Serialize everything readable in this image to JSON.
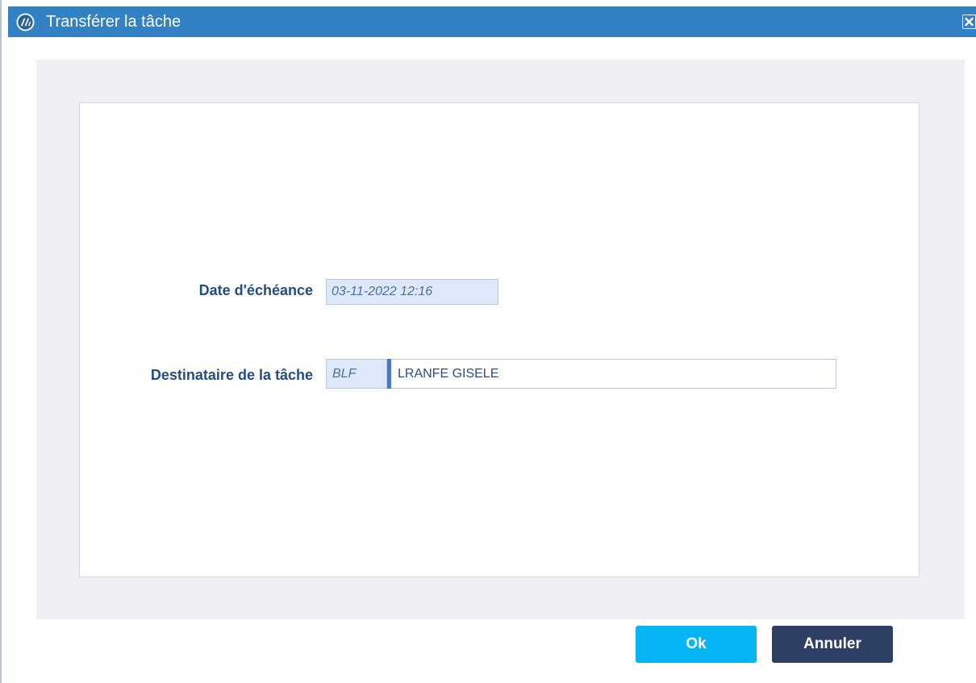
{
  "dialog": {
    "title": "Transférer la tâche",
    "close_label": "✕"
  },
  "form": {
    "due_date": {
      "label": "Date d'échéance",
      "value": "03-11-2022 12:16"
    },
    "recipient": {
      "label": "Destinataire de la tâche",
      "code": "BLF",
      "name": "LRANFE GISELE"
    }
  },
  "buttons": {
    "ok_label": "Ok",
    "cancel_label": "Annuler"
  },
  "colors": {
    "titlebar": "#3281c4",
    "ok_button": "#05b5f3",
    "cancel_button": "#2e3f66",
    "label_text": "#244d80"
  }
}
